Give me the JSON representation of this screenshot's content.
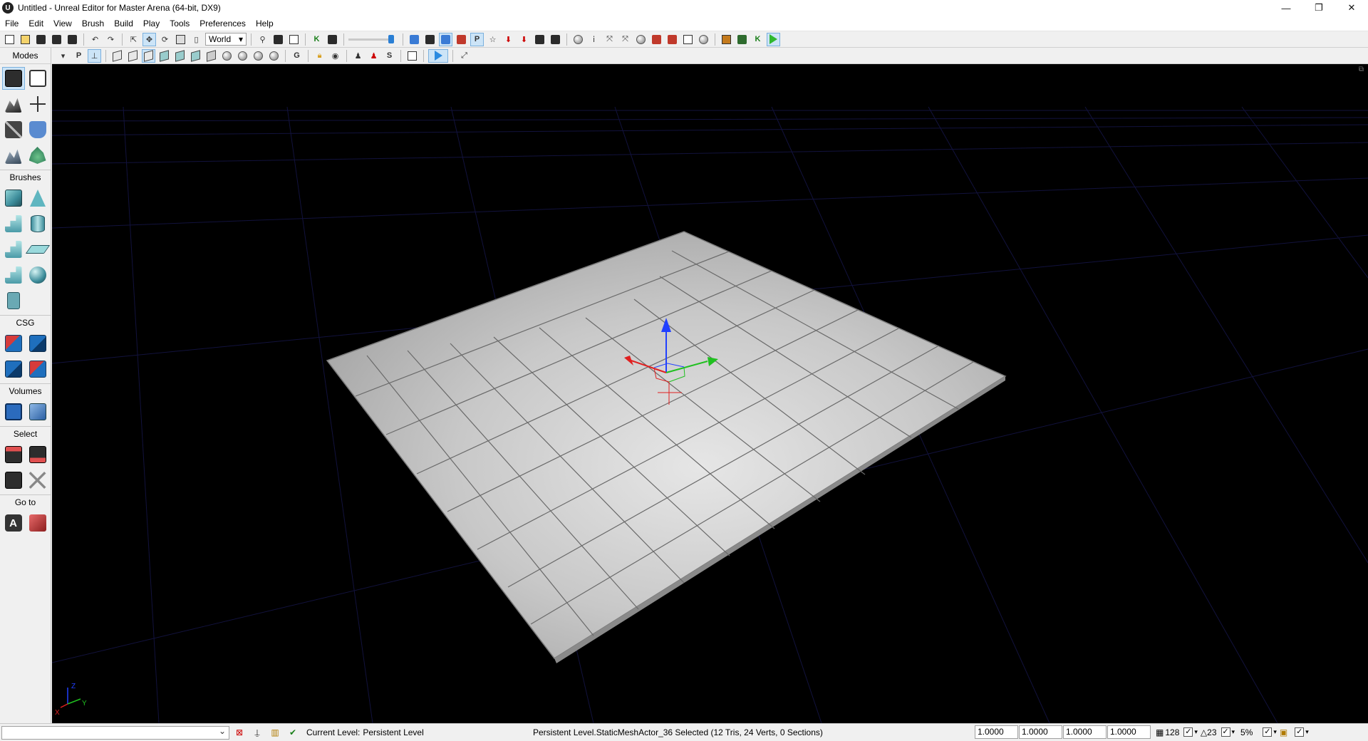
{
  "window": {
    "title": "Untitled - Unreal Editor for Master Arena (64-bit, DX9)",
    "app_icon": "U",
    "controls": [
      "—",
      "❐",
      "✕"
    ]
  },
  "menu": {
    "items": [
      "File",
      "Edit",
      "View",
      "Brush",
      "Build",
      "Play",
      "Tools",
      "Preferences",
      "Help"
    ]
  },
  "toolbar": {
    "coordinate_space": "World",
    "P_label": "P",
    "K_label": "K",
    "G_label": "G",
    "S_label": "S"
  },
  "sidebar": {
    "header": "Modes",
    "sections": {
      "brushes": "Brushes",
      "csg": "CSG",
      "volumes": "Volumes",
      "select": "Select",
      "goto": "Go to"
    },
    "goto_a_label": "A"
  },
  "viewport": {
    "axis_x": "X",
    "axis_y": "Y",
    "axis_z": "Z"
  },
  "status": {
    "current_level_label": "Current Level:",
    "current_level_value": "Persistent Level",
    "selection_text": "Persistent Level.StaticMeshActor_36 Selected (12 Tris, 24 Verts, 0 Sections)",
    "drag_grid": [
      "1.0000",
      "1.0000",
      "1.0000",
      "1.0000"
    ],
    "grid_size": "128",
    "rotation_snap": "23",
    "scale_snap": "5%"
  },
  "colors": {
    "viewport_bg": "#000000",
    "grid_line": "#0d0d3a",
    "gizmo_x": "#e02020",
    "gizmo_y": "#20c020",
    "gizmo_z": "#2040ff",
    "accent": "#2a7fd4"
  }
}
